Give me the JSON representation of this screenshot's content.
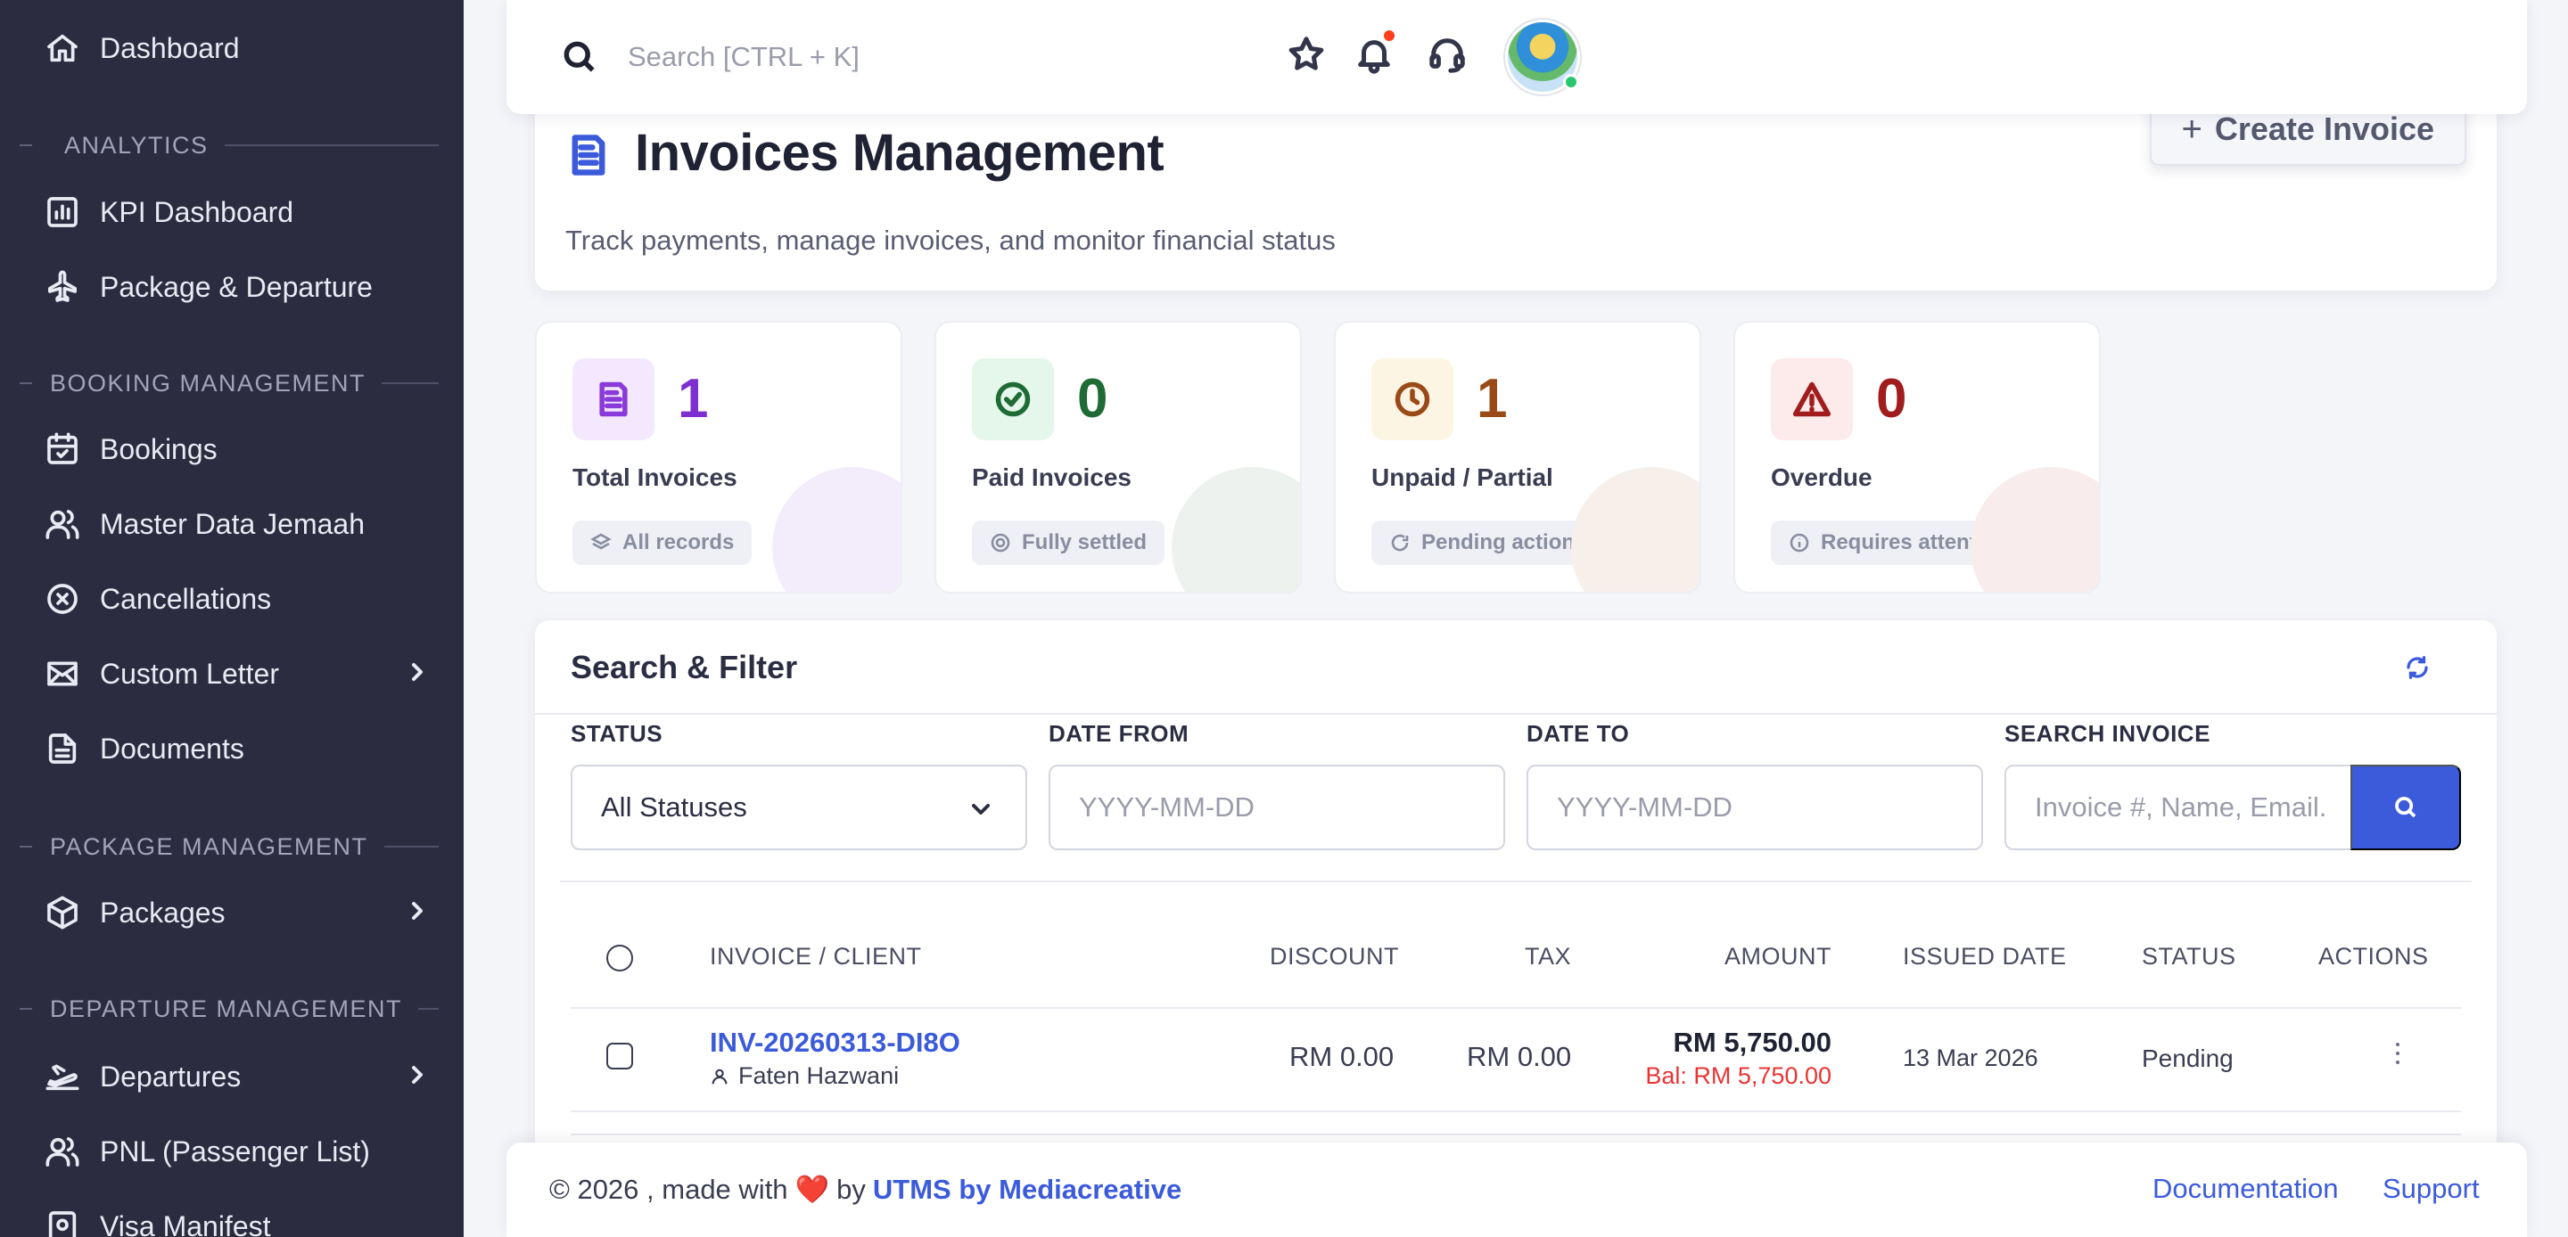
{
  "sidebar": {
    "dashboard": "Dashboard",
    "sections": {
      "analytics": "ANALYTICS",
      "booking": "BOOKING MANAGEMENT",
      "package": "PACKAGE MANAGEMENT",
      "departure": "DEPARTURE MANAGEMENT"
    },
    "items": {
      "kpi": "KPI Dashboard",
      "package_departure": "Package & Departure",
      "bookings": "Bookings",
      "master_jemaah": "Master Data Jemaah",
      "cancellations": "Cancellations",
      "custom_letter": "Custom Letter",
      "documents": "Documents",
      "packages": "Packages",
      "departures": "Departures",
      "pnl": "PNL (Passenger List)",
      "visa": "Visa Manifest"
    }
  },
  "topbar": {
    "search_placeholder": "Search [CTRL + K]"
  },
  "header": {
    "title": "Invoices Management",
    "subtitle": "Track payments, manage invoices, and monitor financial status",
    "create_button": "Create Invoice",
    "create_plus": "+"
  },
  "stats": {
    "total": {
      "value": "1",
      "label": "Total Invoices",
      "badge": "All records",
      "color": "#7e2fd0"
    },
    "paid": {
      "value": "0",
      "label": "Paid Invoices",
      "badge": "Fully settled",
      "color": "#1e6b35"
    },
    "unpaid": {
      "value": "1",
      "label": "Unpaid / Partial",
      "badge": "Pending action",
      "color": "#9a4a16"
    },
    "overdue": {
      "value": "0",
      "label": "Overdue",
      "badge": "Requires attention",
      "color": "#a11c1c"
    }
  },
  "filter": {
    "title": "Search & Filter",
    "status_label": "STATUS",
    "status_value": "All Statuses",
    "date_from_label": "DATE FROM",
    "date_from_placeholder": "YYYY-MM-DD",
    "date_to_label": "DATE TO",
    "date_to_placeholder": "YYYY-MM-DD",
    "search_label": "SEARCH INVOICE",
    "search_placeholder": "Invoice #, Name, Email..."
  },
  "table": {
    "headers": {
      "invoice": "INVOICE / CLIENT",
      "discount": "DISCOUNT",
      "tax": "TAX",
      "amount": "AMOUNT",
      "issued": "ISSUED DATE",
      "status": "STATUS",
      "actions": "ACTIONS"
    },
    "rows": [
      {
        "invoice_no": "INV-20260313-DI8O",
        "client": "Faten Hazwani",
        "discount": "RM 0.00",
        "tax": "RM 0.00",
        "amount": "RM 5,750.00",
        "balance": "Bal: RM 5,750.00",
        "issued": "13 Mar 2026",
        "status": "Pending"
      }
    ]
  },
  "footer": {
    "copyright": "© 2026 , made with",
    "heart": "❤️",
    "by": "by",
    "brand": "UTMS by Mediacreative",
    "documentation": "Documentation",
    "support": "Support"
  }
}
